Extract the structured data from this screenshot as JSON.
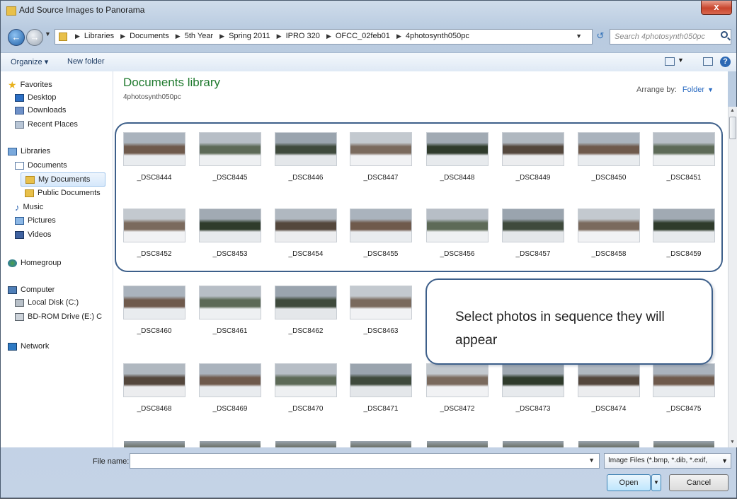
{
  "window": {
    "title": "Add Source Images to Panorama",
    "close_label": "x"
  },
  "address_bar": {
    "crumbs": [
      "Libraries",
      "Documents",
      "5th Year",
      "Spring 2011",
      "IPRO 320",
      "OFCC_02feb01",
      "4photosynth050pc"
    ],
    "search_placeholder": "Search 4photosynth050pc"
  },
  "toolbar": {
    "organize_label": "Organize ▾",
    "new_folder_label": "New folder"
  },
  "nav": {
    "favorites": "Favorites",
    "desktop": "Desktop",
    "downloads": "Downloads",
    "recent": "Recent Places",
    "libraries": "Libraries",
    "documents": "Documents",
    "my_documents": "My Documents",
    "public_documents": "Public Documents",
    "music": "Music",
    "pictures": "Pictures",
    "videos": "Videos",
    "homegroup": "Homegroup",
    "computer": "Computer",
    "local_disk": "Local Disk (C:)",
    "bd_rom": "BD-ROM Drive (E:) C",
    "network": "Network"
  },
  "content": {
    "library_title": "Documents library",
    "library_subtitle": "4photosynth050pc",
    "arrange_label": "Arrange by:",
    "arrange_value": "Folder"
  },
  "files": [
    "_DSC8444",
    "_DSC8445",
    "_DSC8446",
    "_DSC8447",
    "_DSC8448",
    "_DSC8449",
    "_DSC8450",
    "_DSC8451",
    "_DSC8452",
    "_DSC8453",
    "_DSC8454",
    "_DSC8455",
    "_DSC8456",
    "_DSC8457",
    "_DSC8458",
    "_DSC8459",
    "_DSC8460",
    "_DSC8461",
    "_DSC8462",
    "_DSC8463",
    "_DSC8468",
    "_DSC8469",
    "_DSC8470",
    "_DSC8471",
    "_DSC8472",
    "_DSC8473",
    "_DSC8474",
    "_DSC8475"
  ],
  "callout": {
    "text": "Select photos in sequence they will appear"
  },
  "bottom": {
    "file_name_label": "File name:",
    "file_name_value": "",
    "file_type": "Image Files (*.bmp, *.dib, *.exif,",
    "open_label": "Open",
    "cancel_label": "Cancel"
  },
  "colors": {
    "library_title": "#1f7a2e",
    "callout_border": "#3d5f8a",
    "link": "#2a6bc2"
  }
}
